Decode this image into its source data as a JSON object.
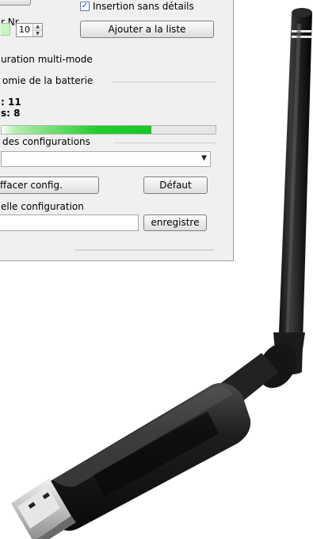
{
  "settings": {
    "checkbox_checked": true,
    "checkbox_label": "Insertion sans détails",
    "nr_label": "r Nr.",
    "number_value": "10",
    "add_button": "Ajouter a la liste",
    "multimode_label": "uration multi-mode"
  },
  "battery": {
    "group_label": "omie de la batterie",
    "value_line_1": ": 11",
    "value_line_2": "s: 8",
    "level_percent": 70
  },
  "configs": {
    "group_label": "des configurations",
    "selected": "",
    "clear_button": "ffacer config.",
    "default_button": "Défaut",
    "new_label": "elle configuration",
    "new_value": "",
    "save_button": "enregistre"
  },
  "colors": {
    "window_bg": "#f0f0f0",
    "progress_green": "#1fcd2c",
    "green_field": "#c9f5c2",
    "device_body": "#1c1c1c"
  },
  "icons": {
    "check": "check-icon",
    "spin_up": "spin-up-icon",
    "spin_down": "spin-down-icon",
    "dropdown_arrow": "chevron-down-icon"
  }
}
